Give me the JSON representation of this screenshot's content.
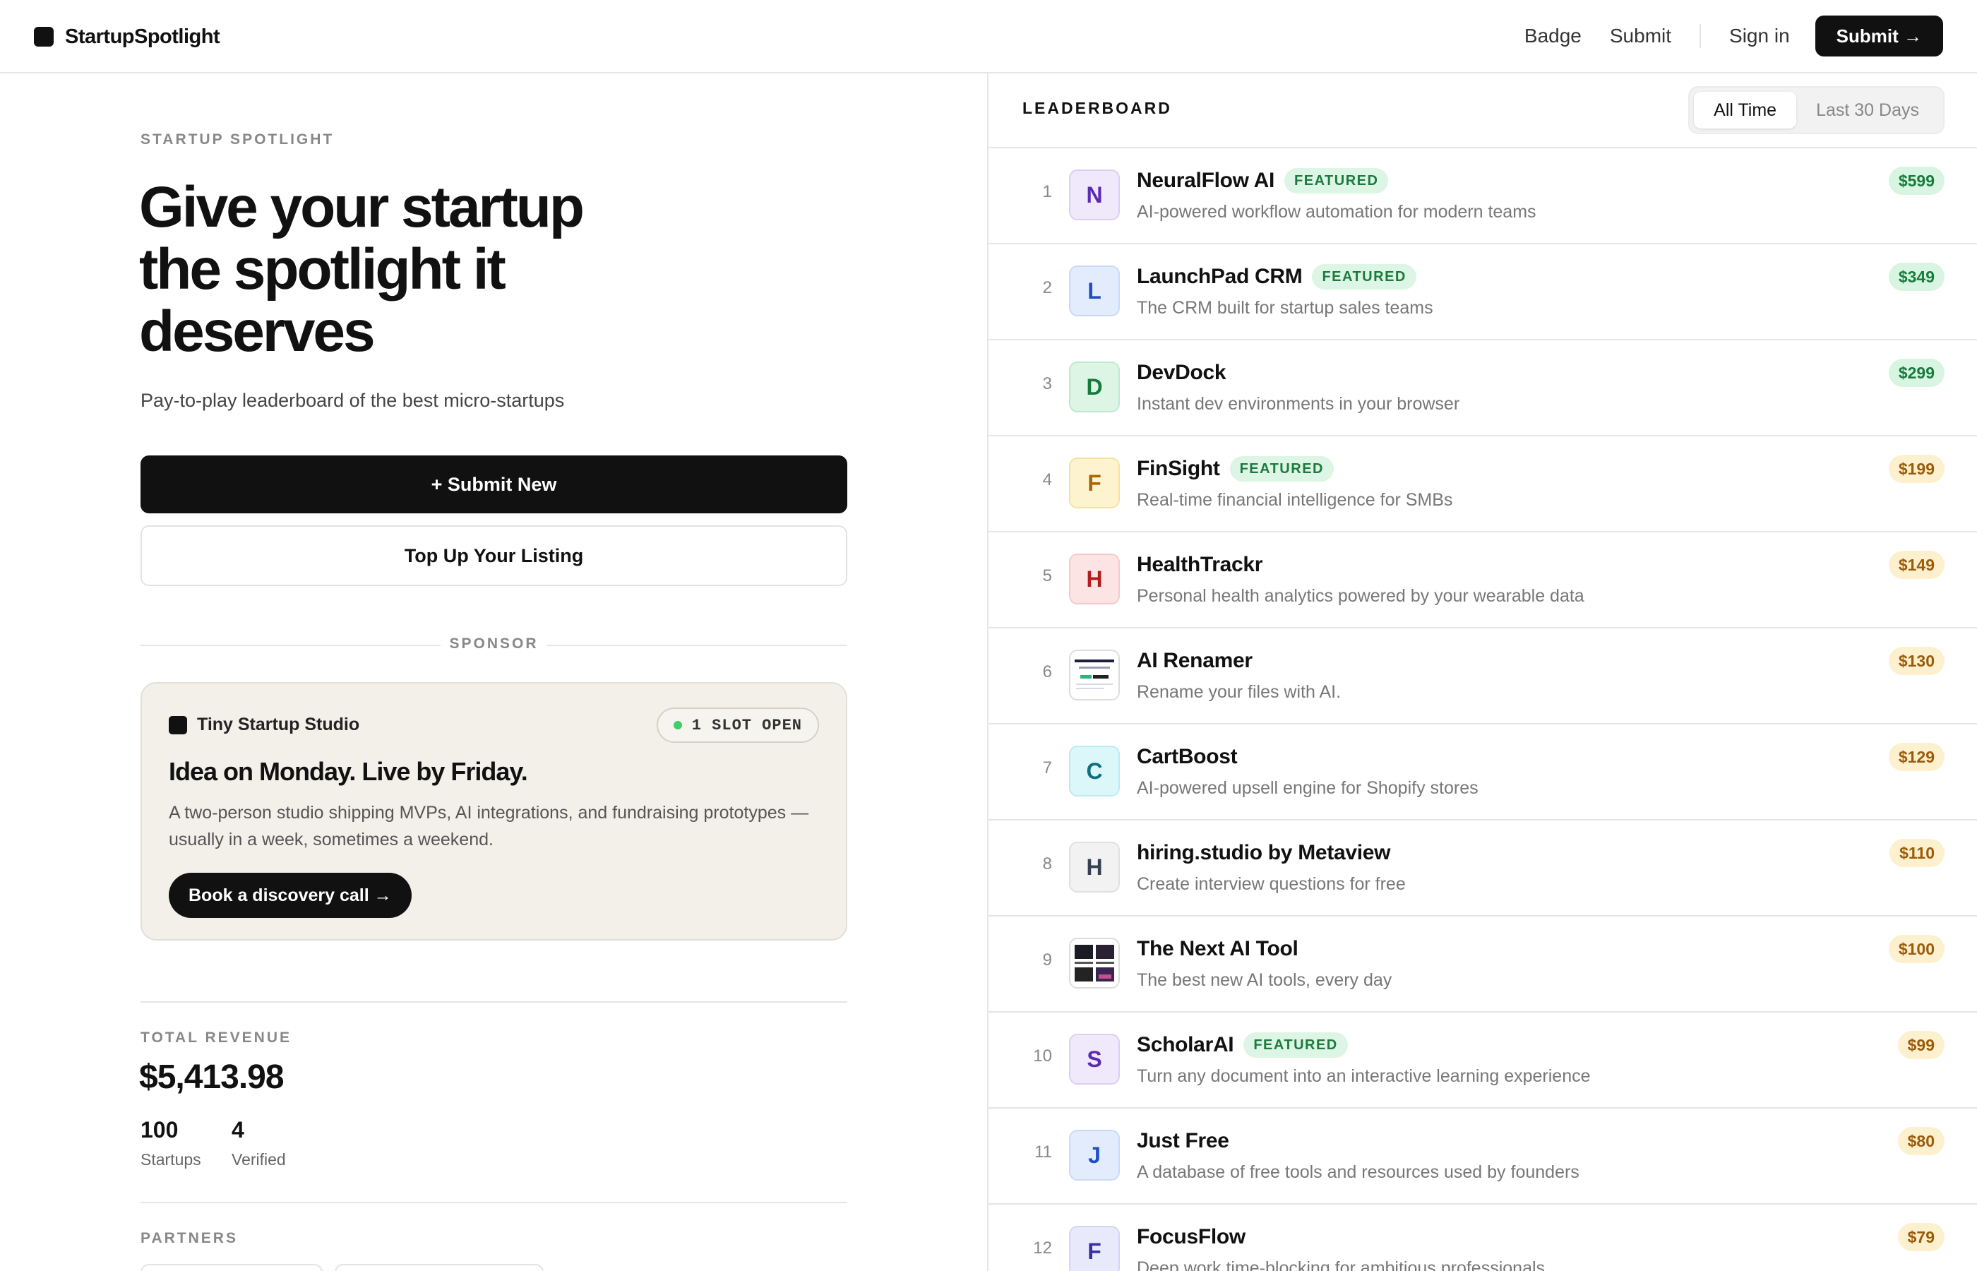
{
  "header": {
    "logo": "StartupSpotlight",
    "nav": {
      "badge": "Badge",
      "submit": "Submit",
      "signin": "Sign in",
      "cta": "Submit →"
    }
  },
  "hero": {
    "eyebrow": "STARTUP SPOTLIGHT",
    "title": "Give your startup the spotlight it deserves",
    "subtitle": "Pay-to-play leaderboard of the best micro-startups",
    "primary_button": "+ Submit New",
    "secondary_button": "Top Up Your Listing"
  },
  "sponsor": {
    "section_label": "SPONSOR",
    "brand": "Tiny Startup Studio",
    "slot": "1 SLOT OPEN",
    "title": "Idea on Monday. Live by Friday.",
    "description": "A two-person studio shipping MVPs, AI integrations, and fundraising prototypes — usually in a week, sometimes a weekend.",
    "cta": "Book a discovery call →"
  },
  "stats": {
    "revenue_label": "TOTAL REVENUE",
    "revenue_value": "$5,413.98",
    "startups_value": "100",
    "startups_label": "Startups",
    "verified_value": "4",
    "verified_label": "Verified",
    "partners_label": "PARTNERS"
  },
  "leaderboard": {
    "title": "LEADERBOARD",
    "tabs": [
      "All Time",
      "Last 30 Days"
    ],
    "active_tab": "All Time",
    "rows": [
      {
        "rank": "1",
        "initial": "N",
        "name": "NeuralFlow AI",
        "featured": "FEATURED",
        "description": "AI-powered workflow automation for modern teams",
        "price": "$599",
        "price_tier": "green",
        "avatar_bg": "#efe9fb",
        "avatar_fg": "#5b2bb5",
        "avatar_border": "#dccff3"
      },
      {
        "rank": "2",
        "initial": "L",
        "name": "LaunchPad CRM",
        "featured": "FEATURED",
        "description": "The CRM built for startup sales teams",
        "price": "$349",
        "price_tier": "green",
        "avatar_bg": "#e3ecfd",
        "avatar_fg": "#1f4fc7",
        "avatar_border": "#c9daf8"
      },
      {
        "rank": "3",
        "initial": "D",
        "name": "DevDock",
        "featured": "",
        "description": "Instant dev environments in your browser",
        "price": "$299",
        "price_tier": "green",
        "avatar_bg": "#dcf5e4",
        "avatar_fg": "#157a3a",
        "avatar_border": "#bfe9cf"
      },
      {
        "rank": "4",
        "initial": "F",
        "name": "FinSight",
        "featured": "FEATURED",
        "description": "Real-time financial intelligence for SMBs",
        "price": "$199",
        "price_tier": "amber",
        "avatar_bg": "#fdf4cf",
        "avatar_fg": "#a8650a",
        "avatar_border": "#f5e2a3"
      },
      {
        "rank": "5",
        "initial": "H",
        "name": "HealthTrackr",
        "featured": "",
        "description": "Personal health analytics powered by your wearable data",
        "price": "$149",
        "price_tier": "amber",
        "avatar_bg": "#fde4e4",
        "avatar_fg": "#b31d1d",
        "avatar_border": "#f6c9c9"
      },
      {
        "rank": "6",
        "initial": "",
        "name": "AI Renamer",
        "featured": "",
        "description": "Rename your files with AI.",
        "price": "$130",
        "price_tier": "amber",
        "avatar_image": "ai-renamer-thumbnail"
      },
      {
        "rank": "7",
        "initial": "C",
        "name": "CartBoost",
        "featured": "",
        "description": "AI-powered upsell engine for Shopify stores",
        "price": "$129",
        "price_tier": "amber",
        "avatar_bg": "#dcf7fa",
        "avatar_fg": "#0f6f80",
        "avatar_border": "#b8ecf2"
      },
      {
        "rank": "8",
        "initial": "H",
        "name": "hiring.studio by Metaview",
        "featured": "",
        "description": "Create interview questions for free",
        "price": "$110",
        "price_tier": "amber",
        "avatar_bg": "#f2f2f3",
        "avatar_fg": "#374151",
        "avatar_border": "#e0e0e2"
      },
      {
        "rank": "9",
        "initial": "",
        "name": "The Next AI Tool",
        "featured": "",
        "description": "The best new AI tools, every day",
        "price": "$100",
        "price_tier": "amber",
        "avatar_image": "next-ai-tool-thumbnail"
      },
      {
        "rank": "10",
        "initial": "S",
        "name": "ScholarAI",
        "featured": "FEATURED",
        "description": "Turn any document into an interactive learning experience",
        "price": "$99",
        "price_tier": "amber",
        "avatar_bg": "#efe9fb",
        "avatar_fg": "#5b2bb5",
        "avatar_border": "#dccff3"
      },
      {
        "rank": "11",
        "initial": "J",
        "name": "Just Free",
        "featured": "",
        "description": "A database of free tools and resources used by founders",
        "price": "$80",
        "price_tier": "amber",
        "avatar_bg": "#e3ecfd",
        "avatar_fg": "#1f4fc7",
        "avatar_border": "#c9daf8"
      },
      {
        "rank": "12",
        "initial": "F",
        "name": "FocusFlow",
        "featured": "",
        "description": "Deep work time-blocking for ambitious professionals",
        "price": "$79",
        "price_tier": "amber",
        "avatar_bg": "#e8e9fb",
        "avatar_fg": "#3730a3",
        "avatar_border": "#d3d5f5"
      }
    ]
  }
}
